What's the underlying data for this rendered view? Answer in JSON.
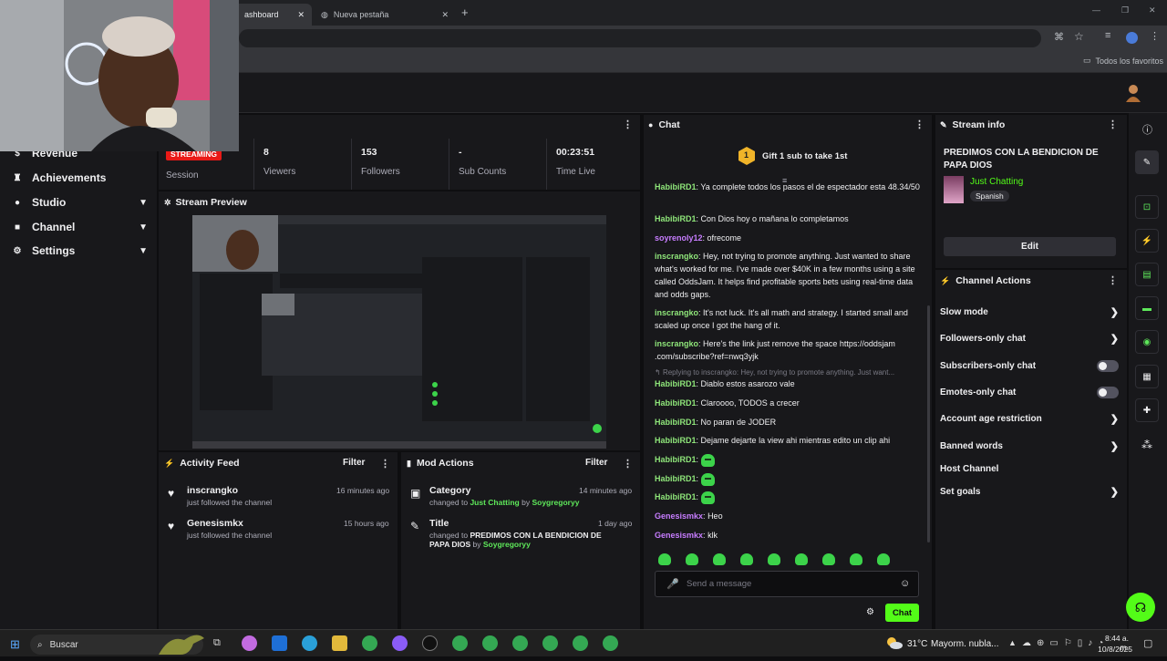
{
  "browser": {
    "tabs": [
      {
        "label": "ashboard"
      },
      {
        "label": "Nueva pestaña"
      }
    ],
    "bookmarks_label": "Todos los favoritos"
  },
  "sidebar": {
    "items": [
      {
        "label": "Revenue",
        "icon": "dollar-icon"
      },
      {
        "label": "Achievements",
        "icon": "trophy-icon"
      },
      {
        "label": "Studio",
        "icon": "studio-icon"
      },
      {
        "label": "Channel",
        "icon": "channel-icon"
      },
      {
        "label": "Settings",
        "icon": "gear-icon"
      }
    ]
  },
  "session": {
    "badge": "STREAMING",
    "label": "Session",
    "stats": [
      {
        "value": "8",
        "label": "Viewers"
      },
      {
        "value": "153",
        "label": "Followers"
      },
      {
        "value": "-",
        "label": "Sub Counts"
      },
      {
        "value": "00:23:51",
        "label": "Time Live"
      }
    ]
  },
  "stream_preview": {
    "title": "Stream Preview"
  },
  "activity_feed": {
    "title": "Activity Feed",
    "filter": "Filter",
    "items": [
      {
        "name": "inscrangko",
        "desc": "just followed the channel",
        "time": "16 minutes ago"
      },
      {
        "name": "Genesismkx",
        "desc": "just followed the channel",
        "time": "15 hours ago"
      }
    ]
  },
  "mod_actions": {
    "title": "Mod Actions",
    "filter": "Filter",
    "items": [
      {
        "title": "Category",
        "desc_prefix": "changed to ",
        "target": "Just Chatting",
        "by": " by ",
        "user": "Soygregoryy",
        "time": "14 minutes ago"
      },
      {
        "title": "Title",
        "desc_prefix": "changed to ",
        "target": "PREDIMOS CON LA BENDICION DE PAPA DIOS",
        "by": " by ",
        "user": "Soygregoryy",
        "time": "1 day ago"
      }
    ]
  },
  "chat": {
    "title": "Chat",
    "gift_text": "Gift 1 sub to take 1st",
    "gift_rank": "1",
    "messages": [
      {
        "user": "HabibiRD1",
        "text": "Ya complete todos los pasos el de espectador esta 48.34/50"
      },
      {
        "user": "HabibiRD1",
        "text": "Con Dios hoy o mañana lo completamos"
      },
      {
        "user": "soyrenoly12",
        "text": "ofrecome"
      },
      {
        "user": "inscrangko",
        "text": "Hey, not trying to promote anything. Just wanted to share what's worked for me. I've made over $40K in a few months using a site called OddsJam. It helps find profitable sports bets using real-time data and odds gaps."
      },
      {
        "user": "inscrangko",
        "text": "It's not luck. It's all math and strategy. I started small and scaled up once I got the hang of it."
      },
      {
        "user": "inscrangko",
        "text": "Here's the link just remove the space https://oddsjam .com/subscribe?ref=nwq3yjk"
      },
      {
        "user": "HabibiRD1",
        "text": "Diablo estos asarozo vale"
      },
      {
        "user": "HabibiRD1",
        "text": "Claroooo, TODOS a crecer"
      },
      {
        "user": "HabibiRD1",
        "text": "No paran de JODER"
      },
      {
        "user": "HabibiRD1",
        "text": "Dejame dejarte la view ahi mientras edito un clip ahi"
      },
      {
        "user": "HabibiRD1",
        "text": ""
      },
      {
        "user": "HabibiRD1",
        "text": ""
      },
      {
        "user": "HabibiRD1",
        "text": ""
      },
      {
        "user": "Genesismkx",
        "text": "Heo"
      },
      {
        "user": "Genesismkx",
        "text": "klk"
      }
    ],
    "reply_text": "Replying to inscrangko: Hey, not trying to promote anything. Just want...",
    "input_placeholder": "Send a message",
    "send_label": "Chat"
  },
  "stream_info": {
    "title": "Stream info",
    "stream_title": "PREDIMOS CON LA BENDICION DE PAPA DIOS",
    "category": "Just Chatting",
    "tag": "Spanish",
    "edit_label": "Edit"
  },
  "channel_actions": {
    "title": "Channel Actions",
    "items": [
      {
        "label": "Slow mode",
        "control": "chevron"
      },
      {
        "label": "Followers-only chat",
        "control": "chevron"
      },
      {
        "label": "Subscribers-only chat",
        "control": "toggle"
      },
      {
        "label": "Emotes-only chat",
        "control": "toggle"
      },
      {
        "label": "Account age restriction",
        "control": "chevron"
      },
      {
        "label": "Banned words",
        "control": "chevron"
      },
      {
        "label": "Host Channel",
        "control": "none"
      },
      {
        "label": "Set goals",
        "control": "chevron"
      }
    ]
  },
  "taskbar": {
    "search_label": "Buscar",
    "weather": "31°C",
    "weather_desc": "Mayorm. nubla...",
    "time": "8:44 a. m.",
    "date": "10/8/2025"
  },
  "colors": {
    "accent": "#53fc18",
    "streaming_badge": "#e91916",
    "background": "#0e0e10",
    "panel": "#18181b"
  }
}
